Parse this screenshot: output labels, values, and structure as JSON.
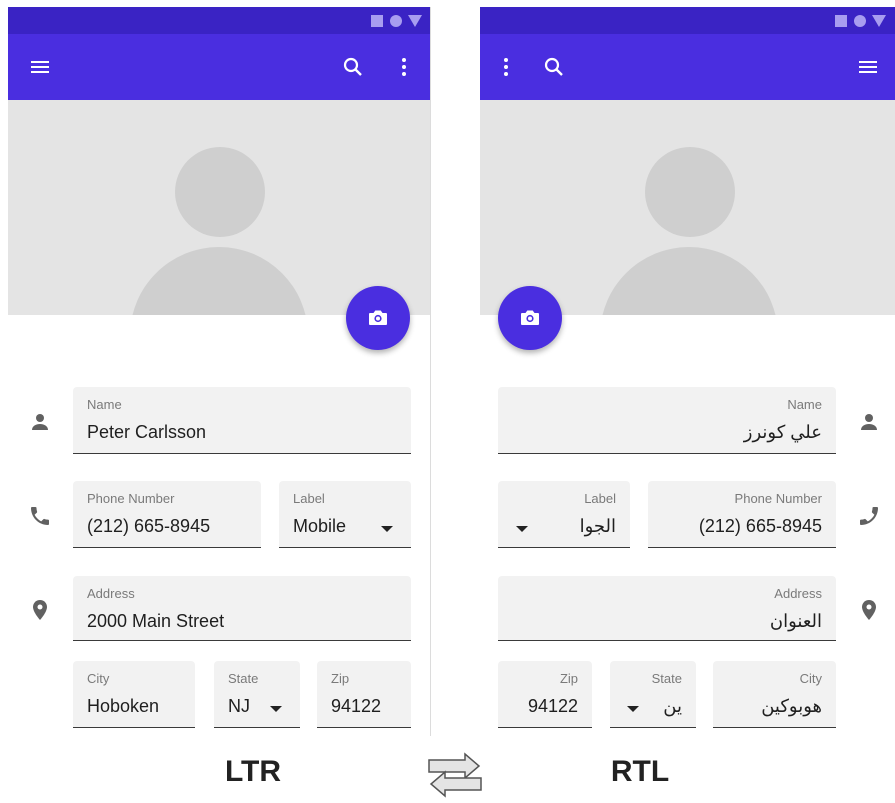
{
  "ltr": {
    "fields": {
      "name": {
        "label": "Name",
        "value": "Peter Carlsson"
      },
      "phone": {
        "label": "Phone Number",
        "value": "(212) 665-8945"
      },
      "phone_label": {
        "label": "Label",
        "value": "Mobile"
      },
      "address": {
        "label": "Address",
        "value": "2000 Main Street"
      },
      "city": {
        "label": "City",
        "value": "Hoboken"
      },
      "state": {
        "label": "State",
        "value": "NJ"
      },
      "zip": {
        "label": "Zip",
        "value": "94122"
      }
    }
  },
  "rtl": {
    "fields": {
      "name": {
        "label": "Name",
        "value": "علي كونرز"
      },
      "phone": {
        "label": "Phone Number",
        "value": "(212) 665-8945"
      },
      "phone_label": {
        "label": "Label",
        "value": "الجوا"
      },
      "address": {
        "label": "Address",
        "value": "العنوان"
      },
      "city": {
        "label": "City",
        "value": "هوبوكين"
      },
      "state": {
        "label": "State",
        "value": "ين"
      },
      "zip": {
        "label": "Zip",
        "value": "94122"
      }
    }
  },
  "captions": {
    "ltr": "LTR",
    "rtl": "RTL"
  },
  "colors": {
    "primary": "#4a2ee0",
    "status_bar": "#3a23c4",
    "field_bg": "#f2f2f2",
    "icon": "#616161"
  },
  "icons": [
    "menu-icon",
    "search-icon",
    "more-vert-icon",
    "camera-icon",
    "person-icon",
    "phone-icon",
    "location-icon",
    "dropdown-arrow-icon",
    "swap-arrows-icon"
  ]
}
